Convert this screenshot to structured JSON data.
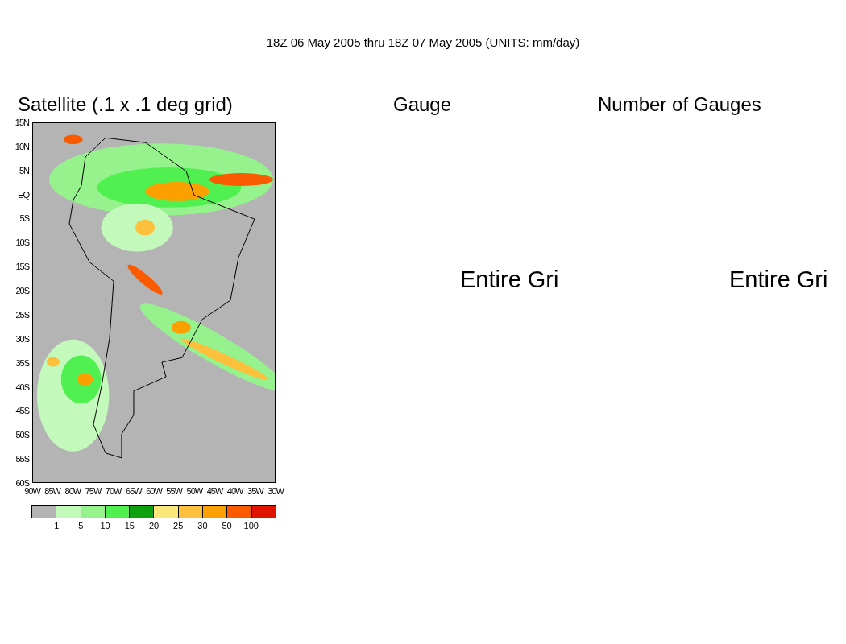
{
  "title": "18Z 06 May 2005 thru 18Z 07 May 2005 (UNITS: mm/day)",
  "panels": [
    {
      "kind": "map",
      "title": "Satellite (.1 x .1 deg grid)"
    },
    {
      "kind": "empty",
      "title": "Gauge",
      "message": "Entire Gri"
    },
    {
      "kind": "empty",
      "title": "Number of Gauges",
      "message": "Entire Gri"
    }
  ],
  "map": {
    "lat_labels": [
      "15N",
      "10N",
      "5N",
      "EQ",
      "5S",
      "10S",
      "15S",
      "20S",
      "25S",
      "30S",
      "35S",
      "40S",
      "45S",
      "50S",
      "55S",
      "60S"
    ],
    "lon_labels": [
      "90W",
      "85W",
      "80W",
      "75W",
      "70W",
      "65W",
      "60W",
      "55W",
      "50W",
      "45W",
      "40W",
      "35W",
      "30W"
    ]
  },
  "legend": {
    "bins": [
      {
        "color": "#b4b4b4"
      },
      {
        "color": "#c3f9bb"
      },
      {
        "color": "#96f28c"
      },
      {
        "color": "#50f050"
      },
      {
        "color": "#0fa00f"
      },
      {
        "color": "#fbe67a"
      },
      {
        "color": "#fdc03c"
      },
      {
        "color": "#fca000"
      },
      {
        "color": "#fa5a00"
      },
      {
        "color": "#e11400"
      }
    ],
    "labels": [
      "1",
      "5",
      "10",
      "15",
      "20",
      "25",
      "30",
      "50",
      "100"
    ]
  }
}
